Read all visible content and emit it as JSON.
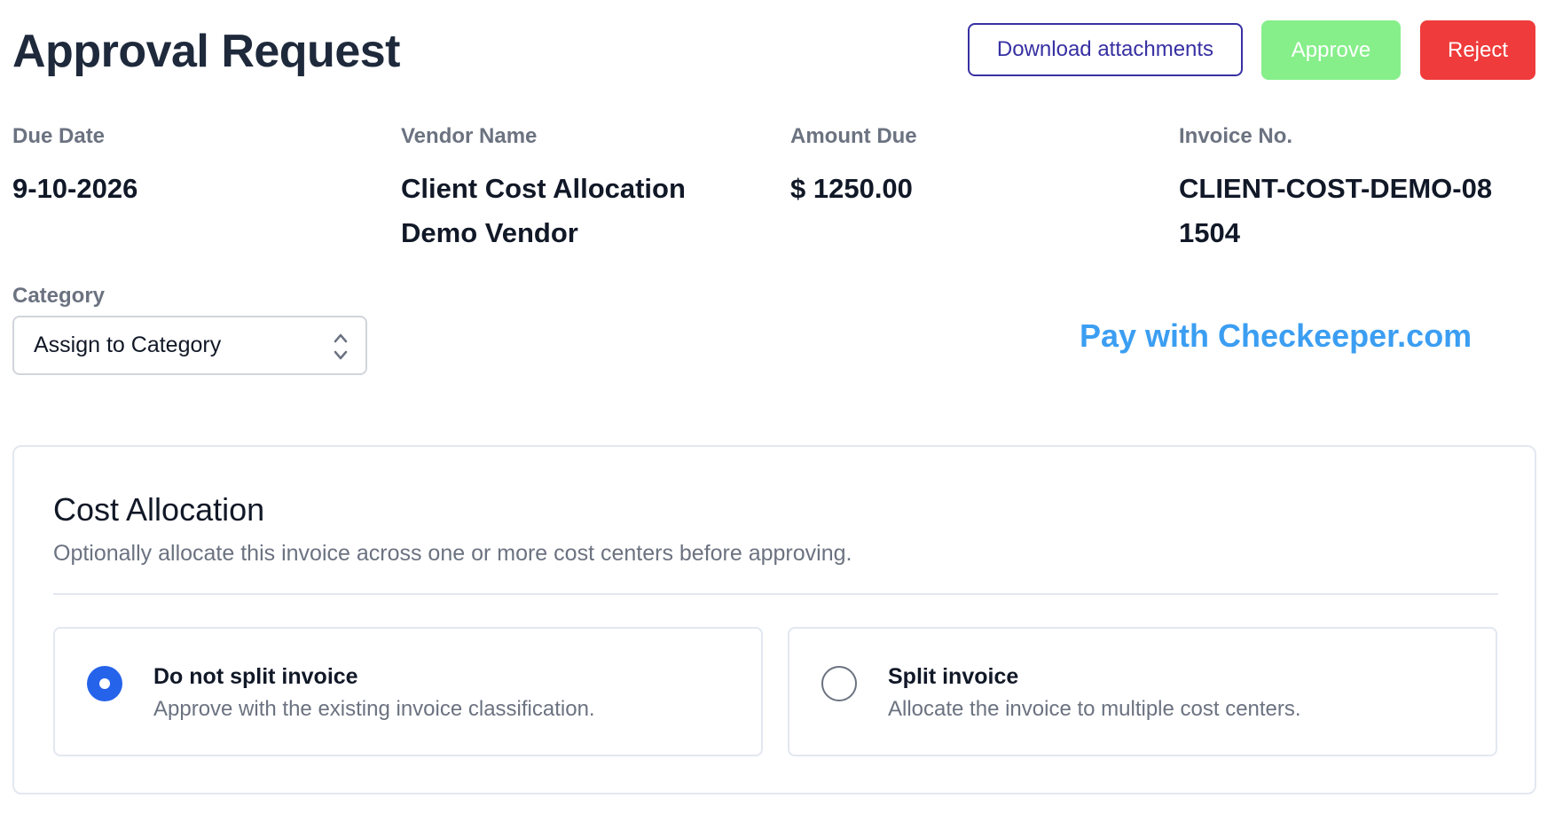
{
  "header": {
    "title": "Approval Request",
    "download_label": "Download attachments",
    "approve_label": "Approve",
    "reject_label": "Reject"
  },
  "fields": {
    "due_date": {
      "label": "Due Date",
      "value": "9-10-2026"
    },
    "vendor_name": {
      "label": "Vendor Name",
      "value": "Client Cost Allocation Demo Vendor"
    },
    "amount_due": {
      "label": "Amount Due",
      "value": "$ 1250.00"
    },
    "invoice_no": {
      "label": "Invoice No.",
      "value": "CLIENT-COST-DEMO-081504"
    }
  },
  "category": {
    "label": "Category",
    "selected": "Assign to Category",
    "icon": "chevron-up-down-icon"
  },
  "pay_link": "Pay with Checkeeper.com",
  "cost_allocation": {
    "title": "Cost Allocation",
    "description": "Optionally allocate this invoice across one or more cost centers before approving.",
    "options": [
      {
        "title": "Do not split invoice",
        "description": "Approve with the existing invoice classification.",
        "selected": true
      },
      {
        "title": "Split invoice",
        "description": "Allocate the invoice to multiple cost centers.",
        "selected": false
      }
    ]
  },
  "colors": {
    "approve": "#86ef8a",
    "reject": "#ef3b3b",
    "link": "#3b9ef2",
    "radio_selected": "#2563eb",
    "download_border": "#3730a3"
  }
}
